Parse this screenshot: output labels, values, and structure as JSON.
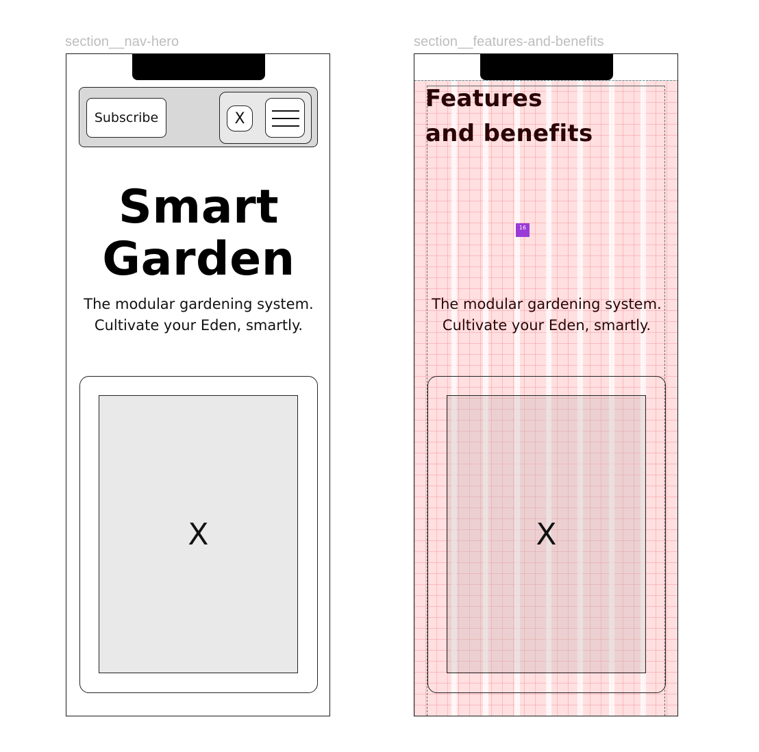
{
  "frames": {
    "nav_hero": {
      "label": "section__nav-hero",
      "nav": {
        "subscribe_label": "Subscribe",
        "close_label": "X"
      },
      "hero": {
        "title_line1": "Smart",
        "title_line2": "Garden",
        "subtitle_line1": "The modular gardening system.",
        "subtitle_line2": "Cultivate your Eden, smartly."
      },
      "card": {
        "image_placeholder": "X"
      }
    },
    "features": {
      "label": "section__features-and-benefits",
      "title_line1": "Features",
      "title_line2": "and benefits",
      "spacing_badge": "16",
      "subtitle_line1": "The modular gardening system.",
      "subtitle_line2": "Cultivate your Eden, smartly.",
      "card": {
        "image_placeholder": "X"
      }
    }
  },
  "colors": {
    "grid_overlay": "#ffdfe0",
    "grid_lines": "#f07882",
    "badge": "#9a3bd6",
    "nav_background": "#d8d8d8",
    "image_placeholder": "#e9e9e9"
  }
}
